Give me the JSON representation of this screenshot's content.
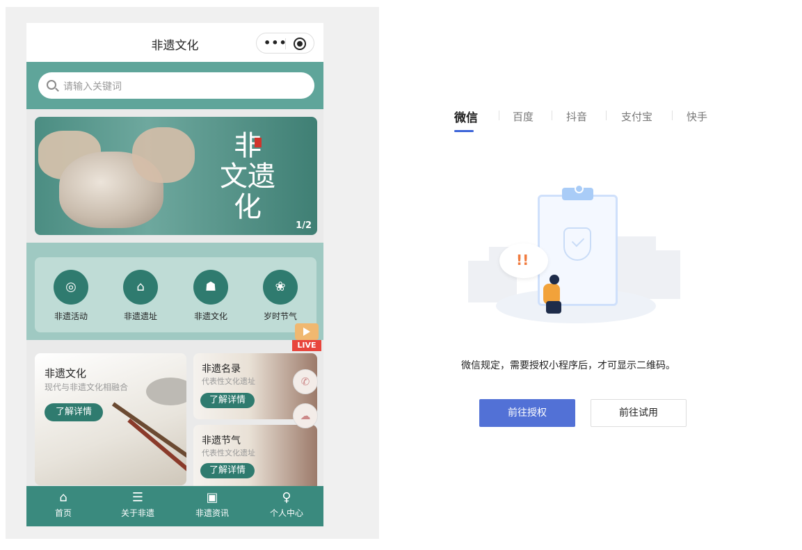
{
  "phone": {
    "title": "非遗文化",
    "capsule": {
      "menu_icon": "more-dots-icon",
      "close_icon": "target-icon"
    },
    "search": {
      "placeholder": "请输入关键词"
    },
    "banner": {
      "calligraphy_line1": "非",
      "calligraphy_line2": "文遗",
      "calligraphy_line3": "化",
      "counter": "1/2"
    },
    "categories": [
      {
        "label": "非遗活动",
        "icon": "swirl-icon"
      },
      {
        "label": "非遗遗址",
        "icon": "pavilion-icon"
      },
      {
        "label": "非遗文化",
        "icon": "book-reader-icon"
      },
      {
        "label": "岁时节气",
        "icon": "lotus-icon"
      }
    ],
    "live_badge": "LIVE",
    "cards": {
      "big": {
        "title": "非遗文化",
        "subtitle": "现代与非遗文化相融合",
        "button": "了解详情"
      },
      "small1": {
        "title": "非遗名录",
        "subtitle": "代表性文化遗址",
        "button": "了解详情"
      },
      "small2": {
        "title": "非遗节气",
        "subtitle": "代表性文化遗址",
        "button": "了解详情"
      }
    },
    "tabbar": [
      {
        "label": "首页",
        "icon": "home-icon"
      },
      {
        "label": "关于非遗",
        "icon": "document-icon"
      },
      {
        "label": "非遗资讯",
        "icon": "message-icon"
      },
      {
        "label": "个人中心",
        "icon": "user-icon"
      }
    ]
  },
  "panel": {
    "platform_tabs": [
      "微信",
      "百度",
      "抖音",
      "支付宝",
      "快手"
    ],
    "active_tab": "微信",
    "message": "微信规定，需要授权小程序后，才可显示二维码。",
    "primary_button": "前往授权",
    "secondary_button": "前往试用",
    "illustration_mark": "!!",
    "accent_color": "#5271d6"
  }
}
